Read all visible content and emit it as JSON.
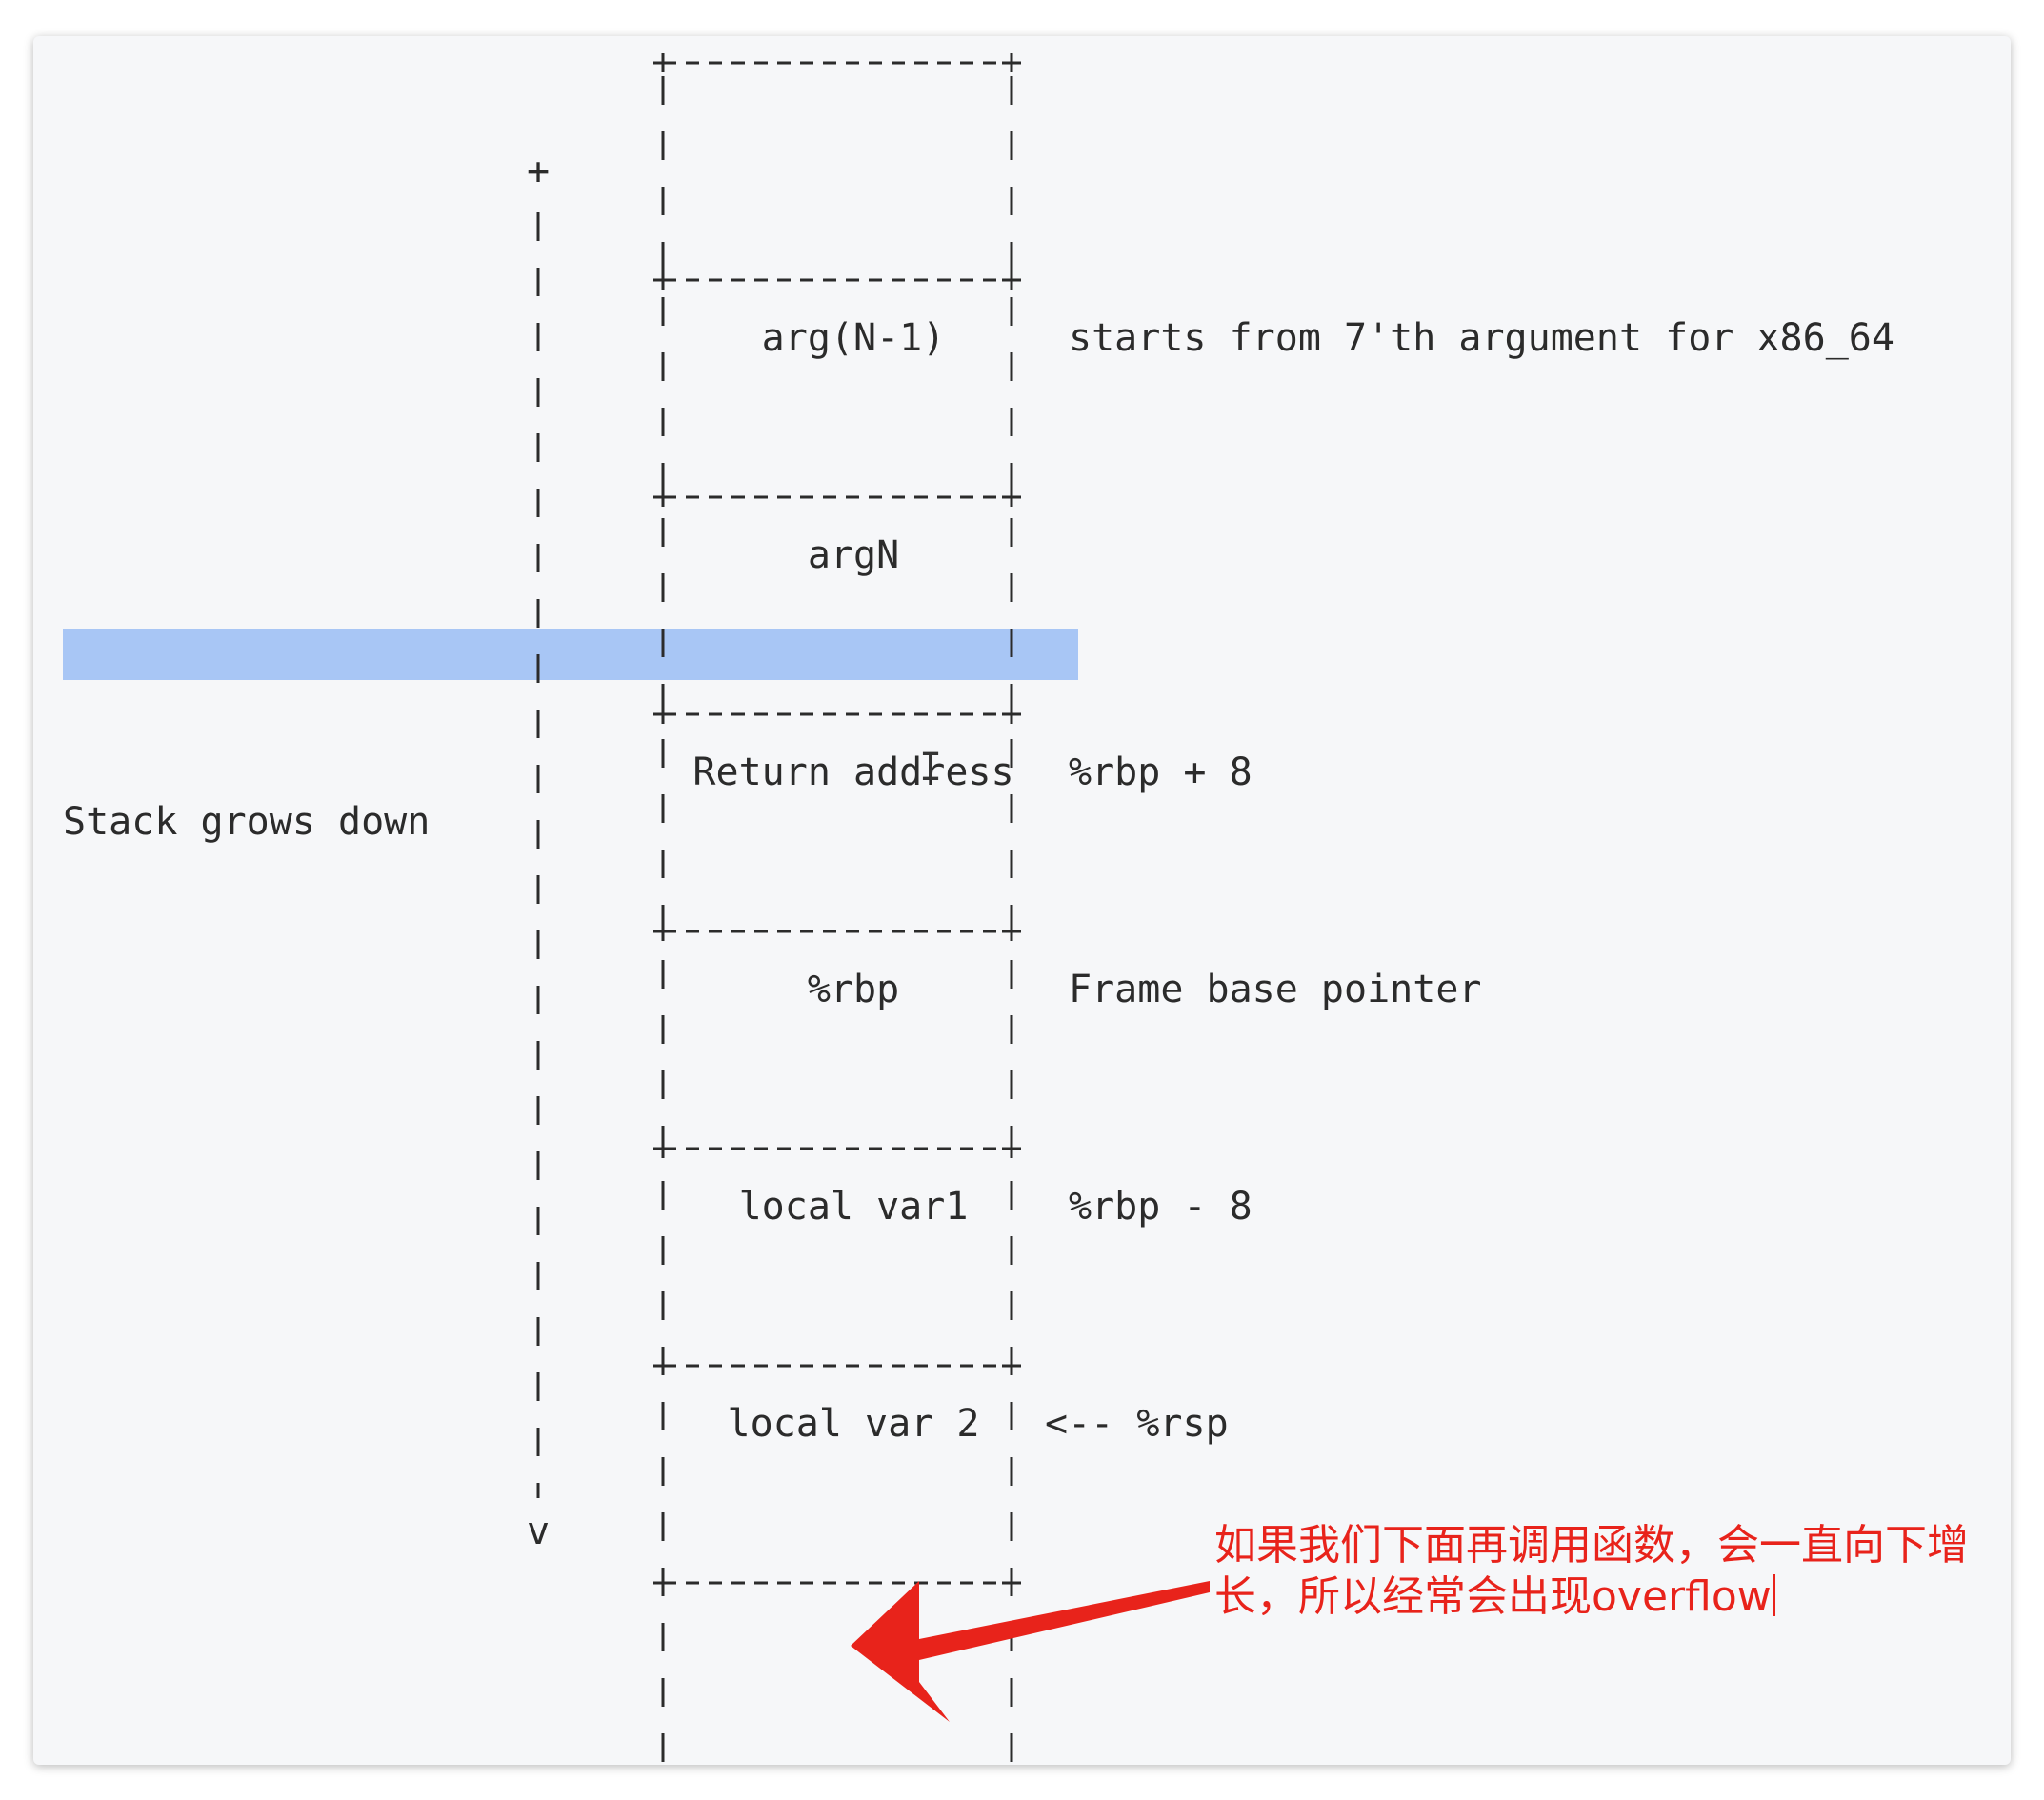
{
  "stack": {
    "cells": [
      {
        "label": "",
        "annotation": ""
      },
      {
        "label": "arg(N-1)",
        "annotation": "starts from 7'th argument for x86_64"
      },
      {
        "label": "argN",
        "annotation": ""
      },
      {
        "label": "Return address",
        "annotation": "%rbp + 8"
      },
      {
        "label": "%rbp",
        "annotation": "Frame base pointer"
      },
      {
        "label": "local var1",
        "annotation": "%rbp - 8"
      },
      {
        "label": "local var 2",
        "annotation": "<-- %rsp"
      },
      {
        "label": "",
        "annotation": ""
      }
    ]
  },
  "growth": {
    "label": "Stack grows down",
    "top_marker": "+",
    "bottom_marker": "v"
  },
  "note": {
    "text": "如果我们下面再调用函数，会一直向下增长，所以经常会出现overflow",
    "color": "#e8231b"
  },
  "colors": {
    "highlight": "#a8c6f5",
    "arrow": "#e8231b",
    "text": "#2b2b2b",
    "background": "#f6f7f9"
  }
}
